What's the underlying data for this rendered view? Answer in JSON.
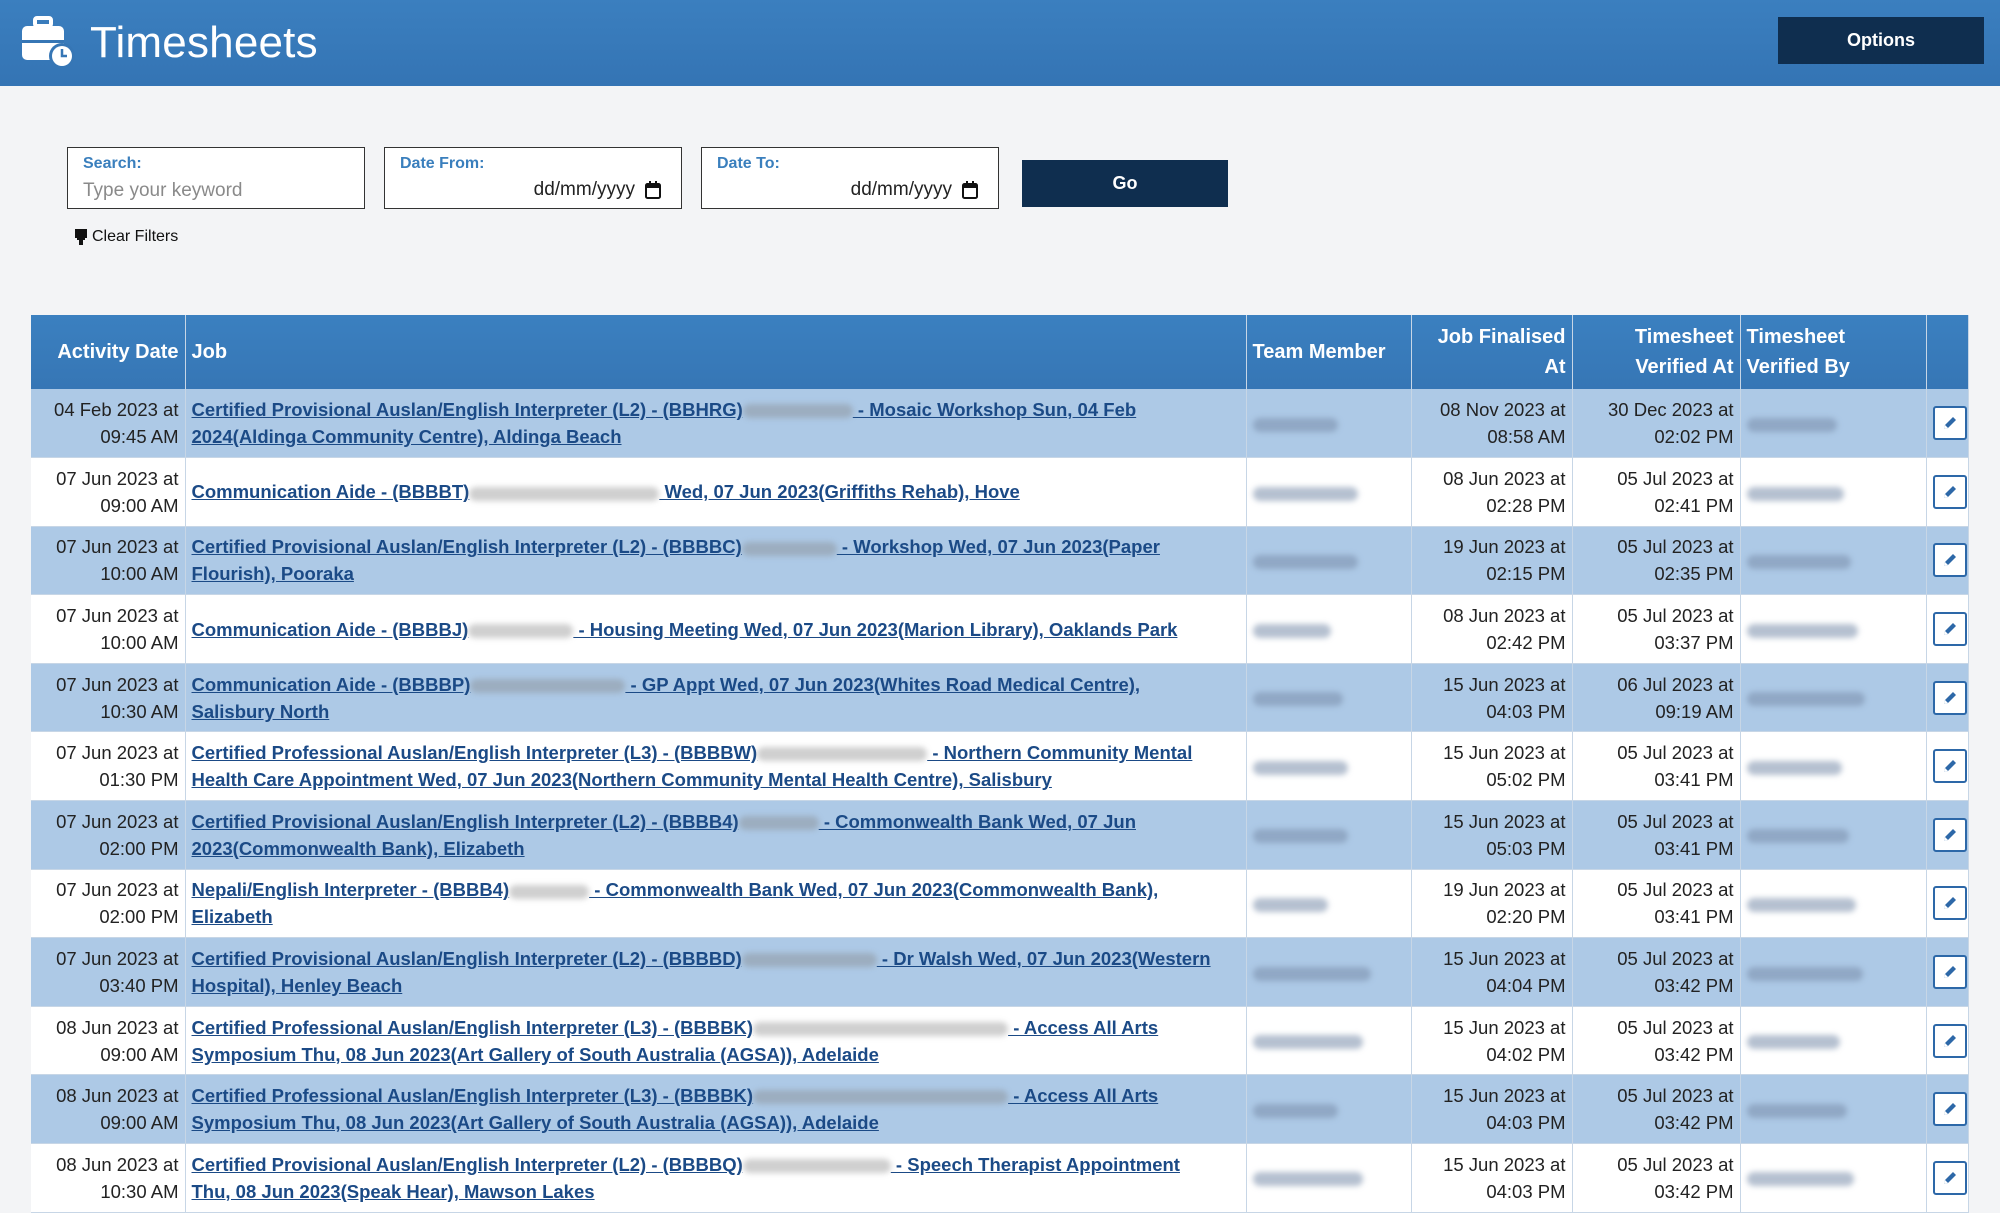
{
  "header": {
    "title": "Timesheets",
    "options_label": "Options",
    "colors": {
      "bar": "#3676b5",
      "dark_button": "#0f2e4f"
    }
  },
  "filters": {
    "search_label": "Search:",
    "search_placeholder": "Type your keyword",
    "date_from_label": "Date From:",
    "date_from_value": "dd/mm/yyyy",
    "date_to_label": "Date To:",
    "date_to_value": "dd/mm/yyyy",
    "go_label": "Go",
    "clear_filters_label": "Clear Filters"
  },
  "table": {
    "headers": {
      "activity_date": "Activity Date",
      "job": "Job",
      "team_member": "Team Member",
      "job_finalised_line1": "Job Finalised",
      "job_finalised_line2": "At",
      "verified_at_line1": "Timesheet",
      "verified_at_line2": "Verified At",
      "verified_by_line1": "Timesheet",
      "verified_by_line2": "Verified By"
    },
    "rows": [
      {
        "activity_date": "04 Feb 2023 at",
        "activity_time": "09:45 AM",
        "job_a": "Certified Provisional Auslan/English Interpreter (L2) - (BBHRG)",
        "job_b": " - Mosaic Workshop Sun, 04 Feb",
        "job_c": "2024(Aldinga Community Centre), Aldinga Beach",
        "finalised_date": "08 Nov 2023 at",
        "finalised_time": "08:58 AM",
        "verified_date": "30 Dec 2023 at",
        "verified_time": "02:02 PM"
      },
      {
        "activity_date": "07 Jun 2023 at",
        "activity_time": "09:00 AM",
        "job_a": "Communication Aide - (BBBBT)",
        "job_b": " Wed, 07 Jun 2023(Griffiths Rehab), Hove",
        "job_c": "",
        "finalised_date": "08 Jun 2023 at",
        "finalised_time": "02:28 PM",
        "verified_date": "05 Jul 2023 at",
        "verified_time": "02:41 PM"
      },
      {
        "activity_date": "07 Jun 2023 at",
        "activity_time": "10:00 AM",
        "job_a": "Certified Provisional Auslan/English Interpreter (L2) - (BBBBC)",
        "job_b": " - Workshop Wed, 07 Jun 2023(Paper",
        "job_c": "Flourish), Pooraka",
        "finalised_date": "19 Jun 2023 at",
        "finalised_time": "02:15 PM",
        "verified_date": "05 Jul 2023 at",
        "verified_time": "02:35 PM"
      },
      {
        "activity_date": "07 Jun 2023 at",
        "activity_time": "10:00 AM",
        "job_a": "Communication Aide - (BBBBJ)",
        "job_b": " - Housing Meeting Wed, 07 Jun 2023(Marion Library), Oaklands Park",
        "job_c": "",
        "finalised_date": "08 Jun 2023 at",
        "finalised_time": "02:42 PM",
        "verified_date": "05 Jul 2023 at",
        "verified_time": "03:37 PM"
      },
      {
        "activity_date": "07 Jun 2023 at",
        "activity_time": "10:30 AM",
        "job_a": "Communication Aide - (BBBBP)",
        "job_b": " - GP Appt Wed, 07 Jun 2023(Whites Road Medical Centre),",
        "job_c": "Salisbury North",
        "finalised_date": "15 Jun 2023 at",
        "finalised_time": "04:03 PM",
        "verified_date": "06 Jul 2023 at",
        "verified_time": "09:19 AM"
      },
      {
        "activity_date": "07 Jun 2023 at",
        "activity_time": "01:30 PM",
        "job_a": "Certified Professional Auslan/English Interpreter (L3) - (BBBBW)",
        "job_b": " - Northern Community Mental",
        "job_c": "Health Care Appointment Wed, 07 Jun 2023(Northern Community Mental Health Centre), Salisbury",
        "finalised_date": "15 Jun 2023 at",
        "finalised_time": "05:02 PM",
        "verified_date": "05 Jul 2023 at",
        "verified_time": "03:41 PM"
      },
      {
        "activity_date": "07 Jun 2023 at",
        "activity_time": "02:00 PM",
        "job_a": "Certified Provisional Auslan/English Interpreter (L2) - (BBBB4)",
        "job_b": " - Commonwealth Bank Wed, 07 Jun",
        "job_c": "2023(Commonwealth Bank), Elizabeth",
        "finalised_date": "15 Jun 2023 at",
        "finalised_time": "05:03 PM",
        "verified_date": "05 Jul 2023 at",
        "verified_time": "03:41 PM"
      },
      {
        "activity_date": "07 Jun 2023 at",
        "activity_time": "02:00 PM",
        "job_a": "Nepali/English Interpreter - (BBBB4)",
        "job_b": " - Commonwealth Bank Wed, 07 Jun 2023(Commonwealth Bank),",
        "job_c": "Elizabeth",
        "finalised_date": "19 Jun 2023 at",
        "finalised_time": "02:20 PM",
        "verified_date": "05 Jul 2023 at",
        "verified_time": "03:41 PM"
      },
      {
        "activity_date": "07 Jun 2023 at",
        "activity_time": "03:40 PM",
        "job_a": "Certified Provisional Auslan/English Interpreter (L2) - (BBBBD)",
        "job_b": " - Dr Walsh Wed, 07 Jun 2023(Western",
        "job_c": "Hospital), Henley Beach",
        "finalised_date": "15 Jun 2023 at",
        "finalised_time": "04:04 PM",
        "verified_date": "05 Jul 2023 at",
        "verified_time": "03:42 PM"
      },
      {
        "activity_date": "08 Jun 2023 at",
        "activity_time": "09:00 AM",
        "job_a": "Certified Professional Auslan/English Interpreter (L3) - (BBBBK)",
        "job_b": " - Access All Arts",
        "job_c": "Symposium Thu, 08 Jun 2023(Art Gallery of South Australia (AGSA)), Adelaide",
        "finalised_date": "15 Jun 2023 at",
        "finalised_time": "04:02 PM",
        "verified_date": "05 Jul 2023 at",
        "verified_time": "03:42 PM"
      },
      {
        "activity_date": "08 Jun 2023 at",
        "activity_time": "09:00 AM",
        "job_a": "Certified Professional Auslan/English Interpreter (L3) - (BBBBK)",
        "job_b": " - Access All Arts",
        "job_c": "Symposium Thu, 08 Jun 2023(Art Gallery of South Australia (AGSA)), Adelaide",
        "finalised_date": "15 Jun 2023 at",
        "finalised_time": "04:03 PM",
        "verified_date": "05 Jul 2023 at",
        "verified_time": "03:42 PM"
      },
      {
        "activity_date": "08 Jun 2023 at",
        "activity_time": "10:30 AM",
        "job_a": "Certified Provisional Auslan/English Interpreter (L2) - (BBBBQ)",
        "job_b": " - Speech Therapist Appointment",
        "job_c": "Thu, 08 Jun 2023(Speak Hear), Mawson Lakes",
        "finalised_date": "15 Jun 2023 at",
        "finalised_time": "04:03 PM",
        "verified_date": "05 Jul 2023 at",
        "verified_time": "03:42 PM"
      }
    ]
  }
}
